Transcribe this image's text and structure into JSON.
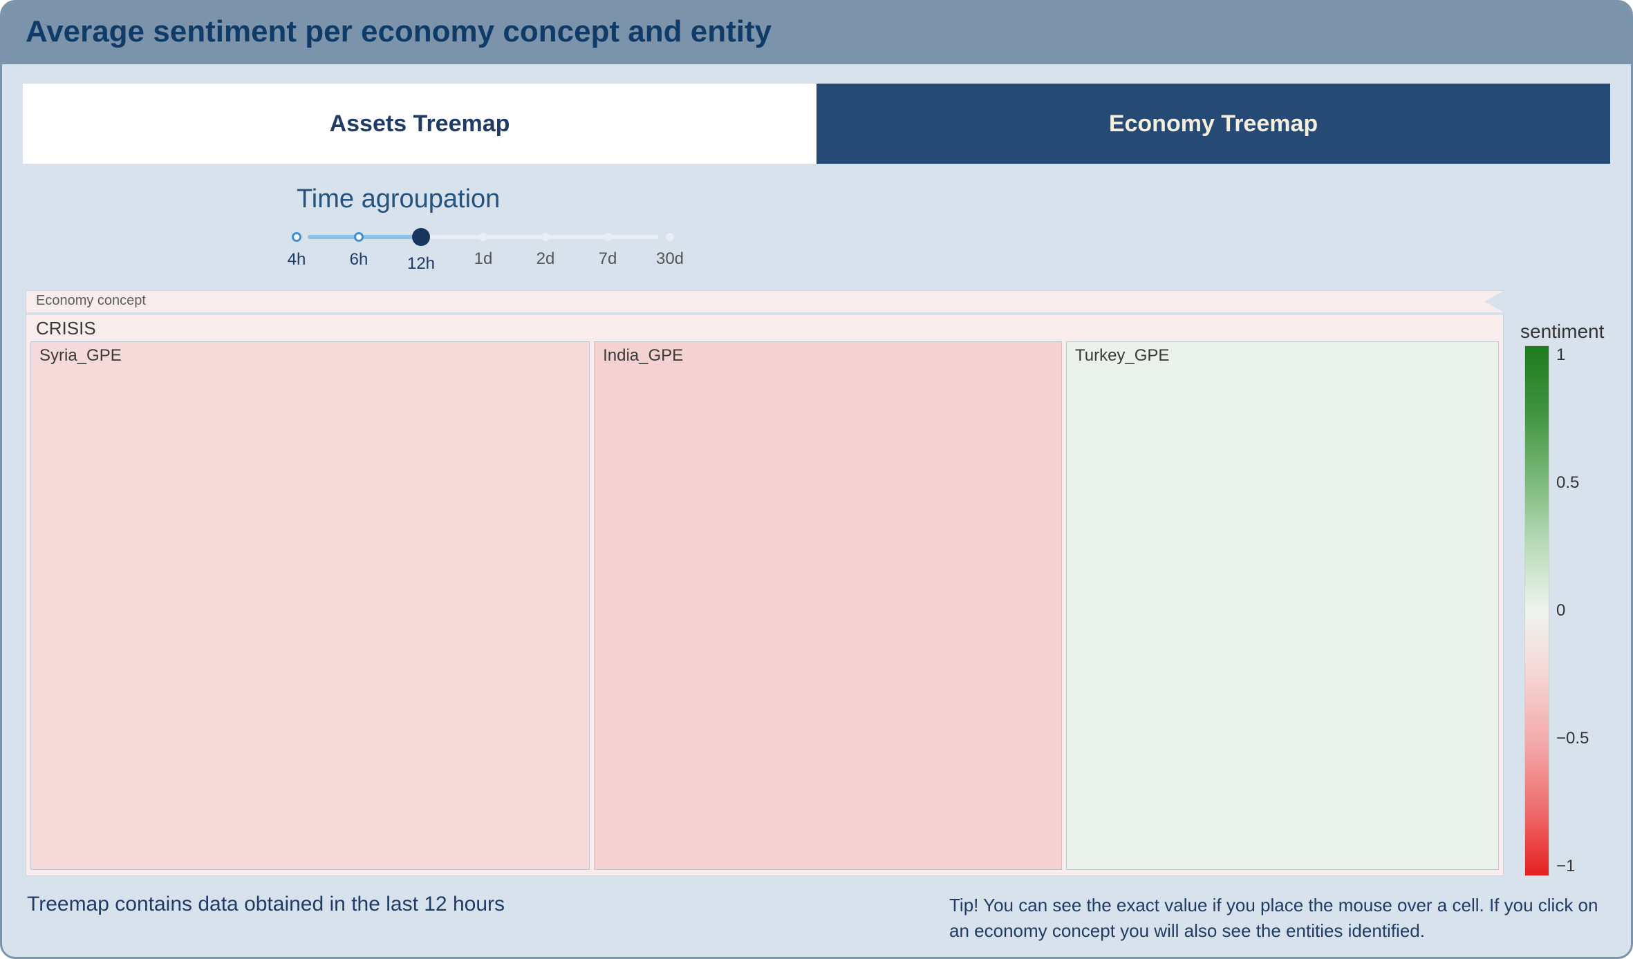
{
  "title": "Average sentiment per economy concept and entity",
  "tabs": [
    {
      "label": "Assets Treemap",
      "active": true
    },
    {
      "label": "Economy Treemap",
      "active": false
    }
  ],
  "time": {
    "title": "Time agroupation",
    "options": [
      "4h",
      "6h",
      "12h",
      "1d",
      "2d",
      "7d",
      "30d"
    ],
    "selected_index": 2
  },
  "treemap": {
    "breadcrumb": "Economy concept",
    "group_label": "CRISIS"
  },
  "legend": {
    "title": "sentiment",
    "ticks": [
      "1",
      "0.5",
      "0",
      "−0.5",
      "−1"
    ]
  },
  "footer": {
    "left": "Treemap contains data obtained in the last 12 hours",
    "right": "Tip! You can see the exact value if you place the mouse over a cell. If you click on an economy concept you will also see the entities identified."
  },
  "chart_data": {
    "type": "treemap",
    "color_scale": {
      "metric": "sentiment",
      "min": -1,
      "max": 1,
      "low_color": "#e62020",
      "mid_color": "#eef4ee",
      "high_color": "#1d7a1d"
    },
    "root": "Economy concept",
    "groups": [
      {
        "name": "CRISIS",
        "children": [
          {
            "name": "Syria_GPE",
            "size": 0.385,
            "sentiment": -0.12,
            "fill": "#f6dada"
          },
          {
            "name": "India_GPE",
            "size": 0.32,
            "sentiment": -0.15,
            "fill": "#f4d2d2"
          },
          {
            "name": "Turkey_GPE",
            "size": 0.295,
            "sentiment": 0.03,
            "fill": "#ebf2ec"
          }
        ]
      }
    ]
  }
}
